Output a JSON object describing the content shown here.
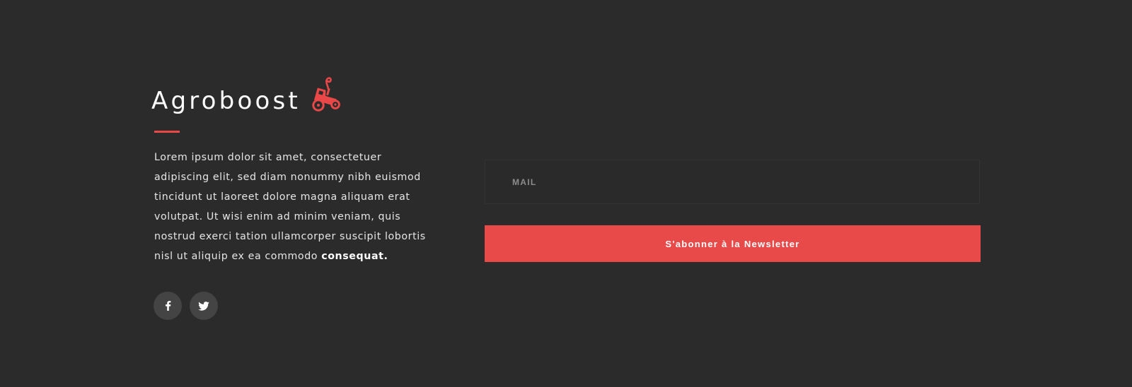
{
  "brand": {
    "name": "Agroboost",
    "logo_icon": "tractor-icon"
  },
  "about": {
    "text": "Lorem ipsum dolor sit amet, consectetuer adipiscing elit, sed diam nonummy nibh euismod tincidunt ut laoreet dolore magna aliquam erat volutpat. Ut wisi enim ad minim veniam, quis nostrud exerci tation ullamcorper suscipit lobortis nisl ut aliquip ex ea commodo",
    "emphasis": "consequat."
  },
  "social": [
    {
      "icon": "facebook-icon"
    },
    {
      "icon": "twitter-icon"
    }
  ],
  "newsletter": {
    "mail_placeholder": "MAIL",
    "mail_value": "",
    "subscribe_label": "S'abonner à la Newsletter"
  },
  "colors": {
    "background": "#2b2b2b",
    "accent": "#e84a4a",
    "social_button": "#444444",
    "text": "#ffffff"
  }
}
